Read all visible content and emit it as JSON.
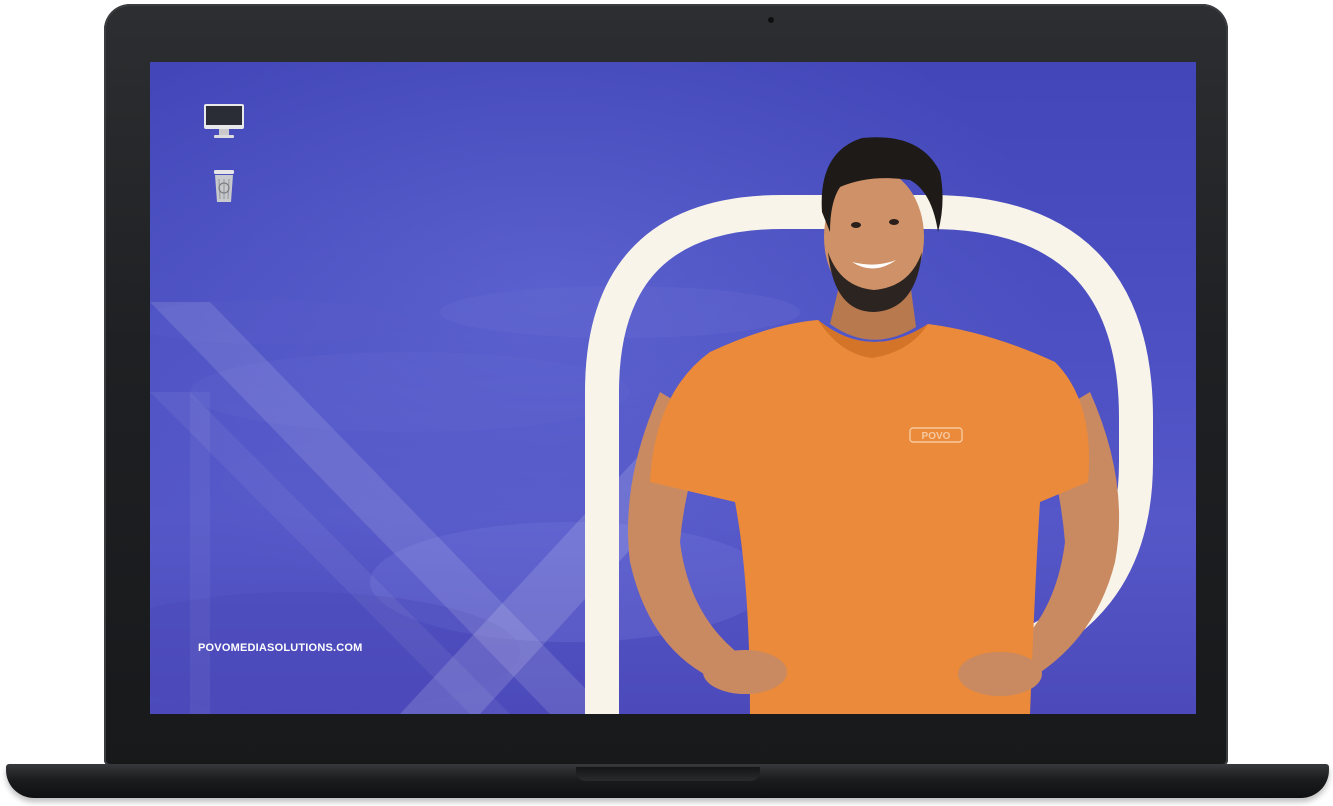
{
  "device": {
    "type": "laptop",
    "bezel_color": "#1e2023"
  },
  "desktop": {
    "wallpaper_colors": [
      "#4246b8",
      "#5557c8"
    ],
    "accent_letter_color": "#f8f4ea",
    "icons": [
      {
        "name": "computer-icon"
      },
      {
        "name": "trash-icon"
      }
    ],
    "website_text": "POVOMEDIASOLUTIONS.COM",
    "shirt_logo_text": "POVO",
    "shirt_color": "#ea8a3a"
  }
}
